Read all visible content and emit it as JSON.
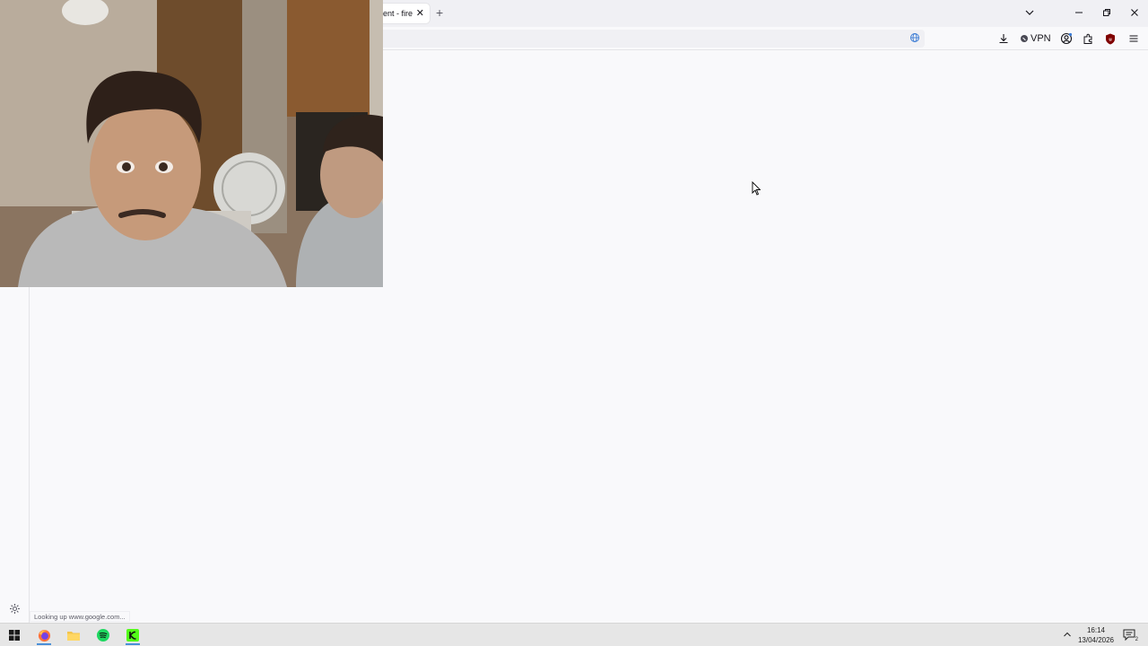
{
  "browser": {
    "tab": {
      "label": "ent - fire",
      "close": "✕"
    },
    "new_tab": "+",
    "vpn_label": "VPN"
  },
  "statusbar": {
    "text": "Looking up www.google.com..."
  },
  "taskbar": {
    "clock_time": "16:14",
    "clock_date": "13/04/2026",
    "notification_count": "2"
  },
  "colors": {
    "accent": "#4a8fd8",
    "page_bg": "#f9f9fb",
    "tabbar_bg": "#f0f0f4",
    "taskbar_bg": "#e6e6e6"
  }
}
